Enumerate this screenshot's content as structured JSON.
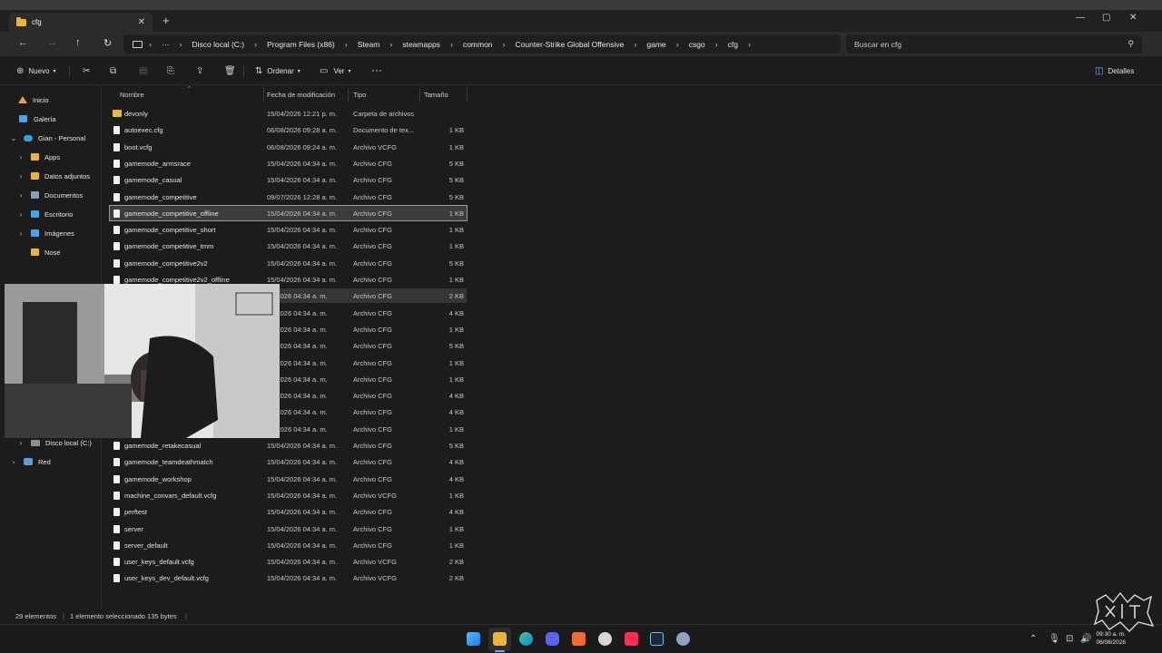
{
  "window": {
    "tab_title": "cfg",
    "new_tab": "+",
    "minimize": "—",
    "maximize": "▢",
    "close": "✕"
  },
  "nav": {
    "back": "←",
    "forward": "→",
    "up": "↑",
    "refresh": "↻",
    "breadcrumb_more": "···",
    "breadcrumbs": [
      "Disco local (C:)",
      "Program Files (x86)",
      "Steam",
      "steamapps",
      "common",
      "Counter-Strike Global Offensive",
      "game",
      "csgo",
      "cfg"
    ],
    "search_placeholder": "Buscar en cfg"
  },
  "toolbar": {
    "new_label": "Nuevo",
    "sort_label": "Ordenar",
    "view_label": "Ver",
    "more": "···",
    "details_label": "Detalles"
  },
  "sidebar": {
    "items": [
      {
        "label": "Inicio",
        "icon": "home-icon"
      },
      {
        "label": "Galería",
        "icon": "gallery-icon"
      },
      {
        "label": "Gian - Personal",
        "icon": "onedrive-icon"
      },
      {
        "label": "Apps",
        "icon": "folder-icon"
      },
      {
        "label": "Datos adjuntos",
        "icon": "folder-icon"
      },
      {
        "label": "Documentos",
        "icon": "documents-icon"
      },
      {
        "label": "Escritorio",
        "icon": "desktop-icon"
      },
      {
        "label": "Imágenes",
        "icon": "pictures-icon"
      },
      {
        "label": "Nose",
        "icon": "folder-icon"
      },
      {
        "label": "Disco local (C:)",
        "icon": "drive-icon"
      },
      {
        "label": "Red",
        "icon": "network-icon"
      }
    ]
  },
  "columns": {
    "name": "Nombre",
    "date": "Fecha de modificación",
    "type": "Tipo",
    "size": "Tamaño"
  },
  "files": [
    {
      "name": "devonly",
      "date": "15/04/2026 12:21 p. m.",
      "type": "Carpeta de archivos",
      "size": ""
    },
    {
      "name": "autoexec.cfg",
      "date": "06/08/2026 09:28 a. m.",
      "type": "Documento de tex...",
      "size": "1 KB"
    },
    {
      "name": "boot.vcfg",
      "date": "06/08/2026 09:24 a. m.",
      "type": "Archivo VCFG",
      "size": "1 KB"
    },
    {
      "name": "gamemode_armsrace",
      "date": "15/04/2026 04:34 a. m.",
      "type": "Archivo CFG",
      "size": "5 KB"
    },
    {
      "name": "gamemode_casual",
      "date": "15/04/2026 04:34 a. m.",
      "type": "Archivo CFG",
      "size": "5 KB"
    },
    {
      "name": "gamemode_competitive",
      "date": "09/07/2026 12:28 a. m.",
      "type": "Archivo CFG",
      "size": "5 KB"
    },
    {
      "name": "gamemode_competitive_offline",
      "date": "15/04/2026 04:34 a. m.",
      "type": "Archivo CFG",
      "size": "1 KB"
    },
    {
      "name": "gamemode_competitive_short",
      "date": "15/04/2026 04:34 a. m.",
      "type": "Archivo CFG",
      "size": "1 KB"
    },
    {
      "name": "gamemode_competitive_tmm",
      "date": "15/04/2026 04:34 a. m.",
      "type": "Archivo CFG",
      "size": "1 KB"
    },
    {
      "name": "gamemode_competitive2v2",
      "date": "15/04/2026 04:34 a. m.",
      "type": "Archivo CFG",
      "size": "5 KB"
    },
    {
      "name": "gamemode_competitive2v2_offline",
      "date": "15/04/2026 04:34 a. m.",
      "type": "Archivo CFG",
      "size": "1 KB"
    },
    {
      "name": "",
      "date": "04/2026 04:34 a. m.",
      "type": "Archivo CFG",
      "size": "2 KB"
    },
    {
      "name": "",
      "date": "04/2026 04:34 a. m.",
      "type": "Archivo CFG",
      "size": "4 KB"
    },
    {
      "name": "",
      "date": "04/2026 04:34 a. m.",
      "type": "Archivo CFG",
      "size": "1 KB"
    },
    {
      "name": "",
      "date": "04/2026 04:34 a. m.",
      "type": "Archivo CFG",
      "size": "5 KB"
    },
    {
      "name": "",
      "date": "04/2026 04:34 a. m.",
      "type": "Archivo CFG",
      "size": "1 KB"
    },
    {
      "name": "",
      "date": "04/2026 04:34 a. m.",
      "type": "Archivo CFG",
      "size": "1 KB"
    },
    {
      "name": "",
      "date": "04/2026 04:34 a. m.",
      "type": "Archivo CFG",
      "size": "4 KB"
    },
    {
      "name": "",
      "date": "04/2026 04:34 a. m.",
      "type": "Archivo CFG",
      "size": "4 KB"
    },
    {
      "name": "",
      "date": "04/2026 04:34 a. m.",
      "type": "Archivo CFG",
      "size": "1 KB"
    },
    {
      "name": "gamemode_retakecasual",
      "date": "15/04/2026 04:34 a. m.",
      "type": "Archivo CFG",
      "size": "5 KB"
    },
    {
      "name": "gamemode_teamdeathmatch",
      "date": "15/04/2026 04:34 a. m.",
      "type": "Archivo CFG",
      "size": "4 KB"
    },
    {
      "name": "gamemode_workshop",
      "date": "15/04/2026 04:34 a. m.",
      "type": "Archivo CFG",
      "size": "4 KB"
    },
    {
      "name": "machine_convars_default.vcfg",
      "date": "15/04/2026 04:34 a. m.",
      "type": "Archivo VCFG",
      "size": "1 KB"
    },
    {
      "name": "perftest",
      "date": "15/04/2026 04:34 a. m.",
      "type": "Archivo CFG",
      "size": "4 KB"
    },
    {
      "name": "server",
      "date": "15/04/2026 04:34 a. m.",
      "type": "Archivo CFG",
      "size": "1 KB"
    },
    {
      "name": "server_default",
      "date": "15/04/2026 04:34 a. m.",
      "type": "Archivo CFG",
      "size": "1 KB"
    },
    {
      "name": "user_keys_default.vcfg",
      "date": "15/04/2026 04:34 a. m.",
      "type": "Archivo VCFG",
      "size": "2 KB"
    },
    {
      "name": "user_keys_dev_default.vcfg",
      "date": "15/04/2026 04:34 a. m.",
      "type": "Archivo VCFG",
      "size": "2 KB"
    }
  ],
  "status": {
    "count": "29 elementos",
    "selection": "1 elemento seleccionado 135 bytes"
  },
  "taskbar": {
    "time": "09:30 a. m.",
    "date": "06/08/2026"
  }
}
